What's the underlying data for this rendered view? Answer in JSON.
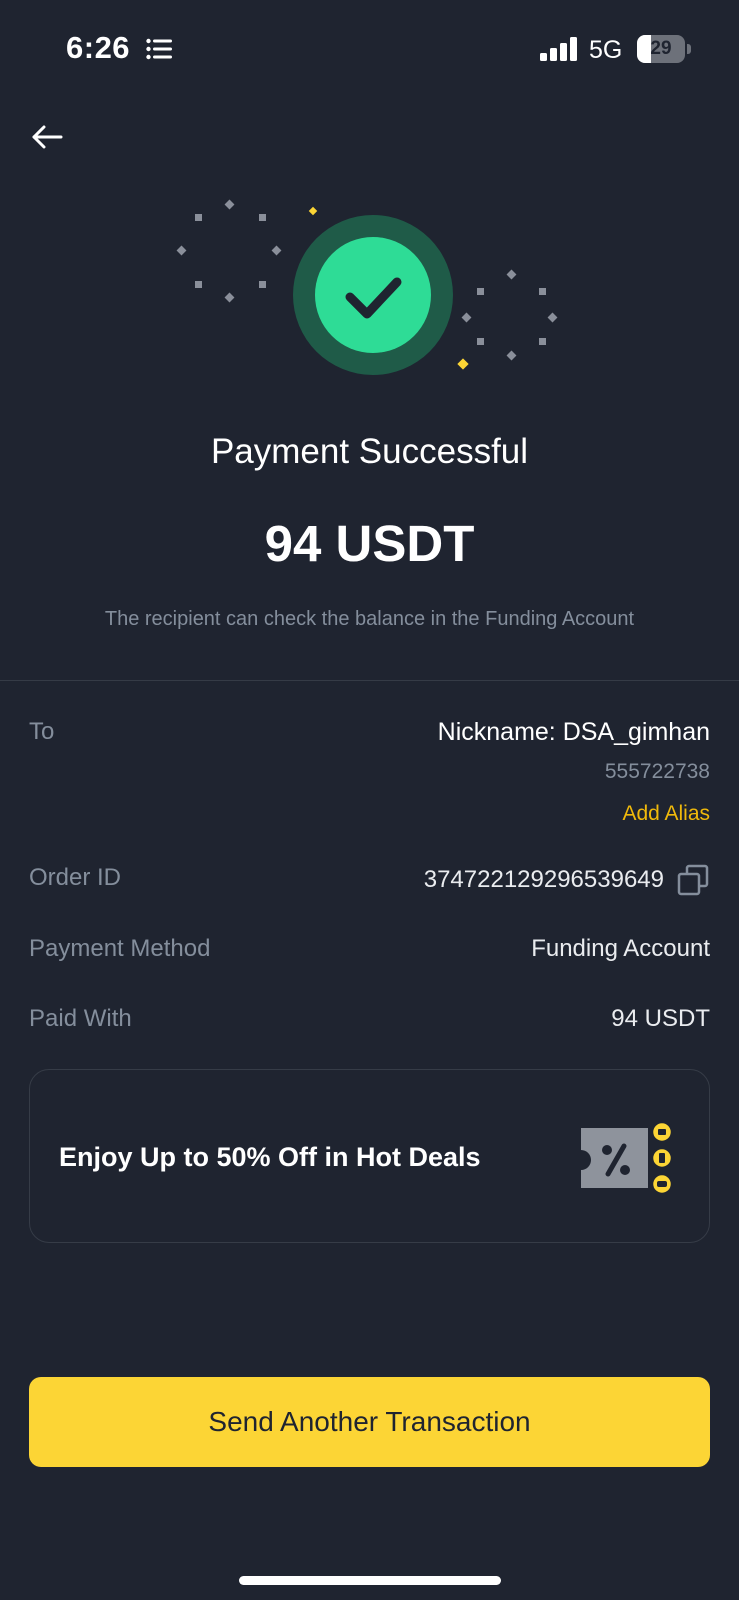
{
  "status_bar": {
    "time": "6:26",
    "network": "5G",
    "battery_level": "29",
    "battery_fraction": 0.29
  },
  "icons": {
    "back": "arrow-left-icon",
    "success": "check-circle-icon",
    "copy": "copy-icon",
    "coupon": "coupon-icon"
  },
  "colors": {
    "background": "#1f2430",
    "success_green": "#2edc96",
    "success_ring": "#1f5b48",
    "accent_yellow": "#fcd535",
    "link_yellow": "#f0b90b",
    "muted_text": "#848e9c"
  },
  "result": {
    "title": "Payment Successful",
    "amount": "94 USDT",
    "subtitle": "The recipient can check the balance in the Funding Account"
  },
  "details": {
    "to_label": "To",
    "to_nickname": "Nickname: DSA_gimhan",
    "to_uid": "555722738",
    "add_alias": "Add Alias",
    "order_id_label": "Order ID",
    "order_id": "374722129296539649",
    "payment_method_label": "Payment Method",
    "payment_method": "Funding Account",
    "paid_with_label": "Paid With",
    "paid_with": "94 USDT"
  },
  "promo": {
    "text": "Enjoy Up to 50% Off in Hot Deals"
  },
  "actions": {
    "primary": "Send Another Transaction"
  }
}
